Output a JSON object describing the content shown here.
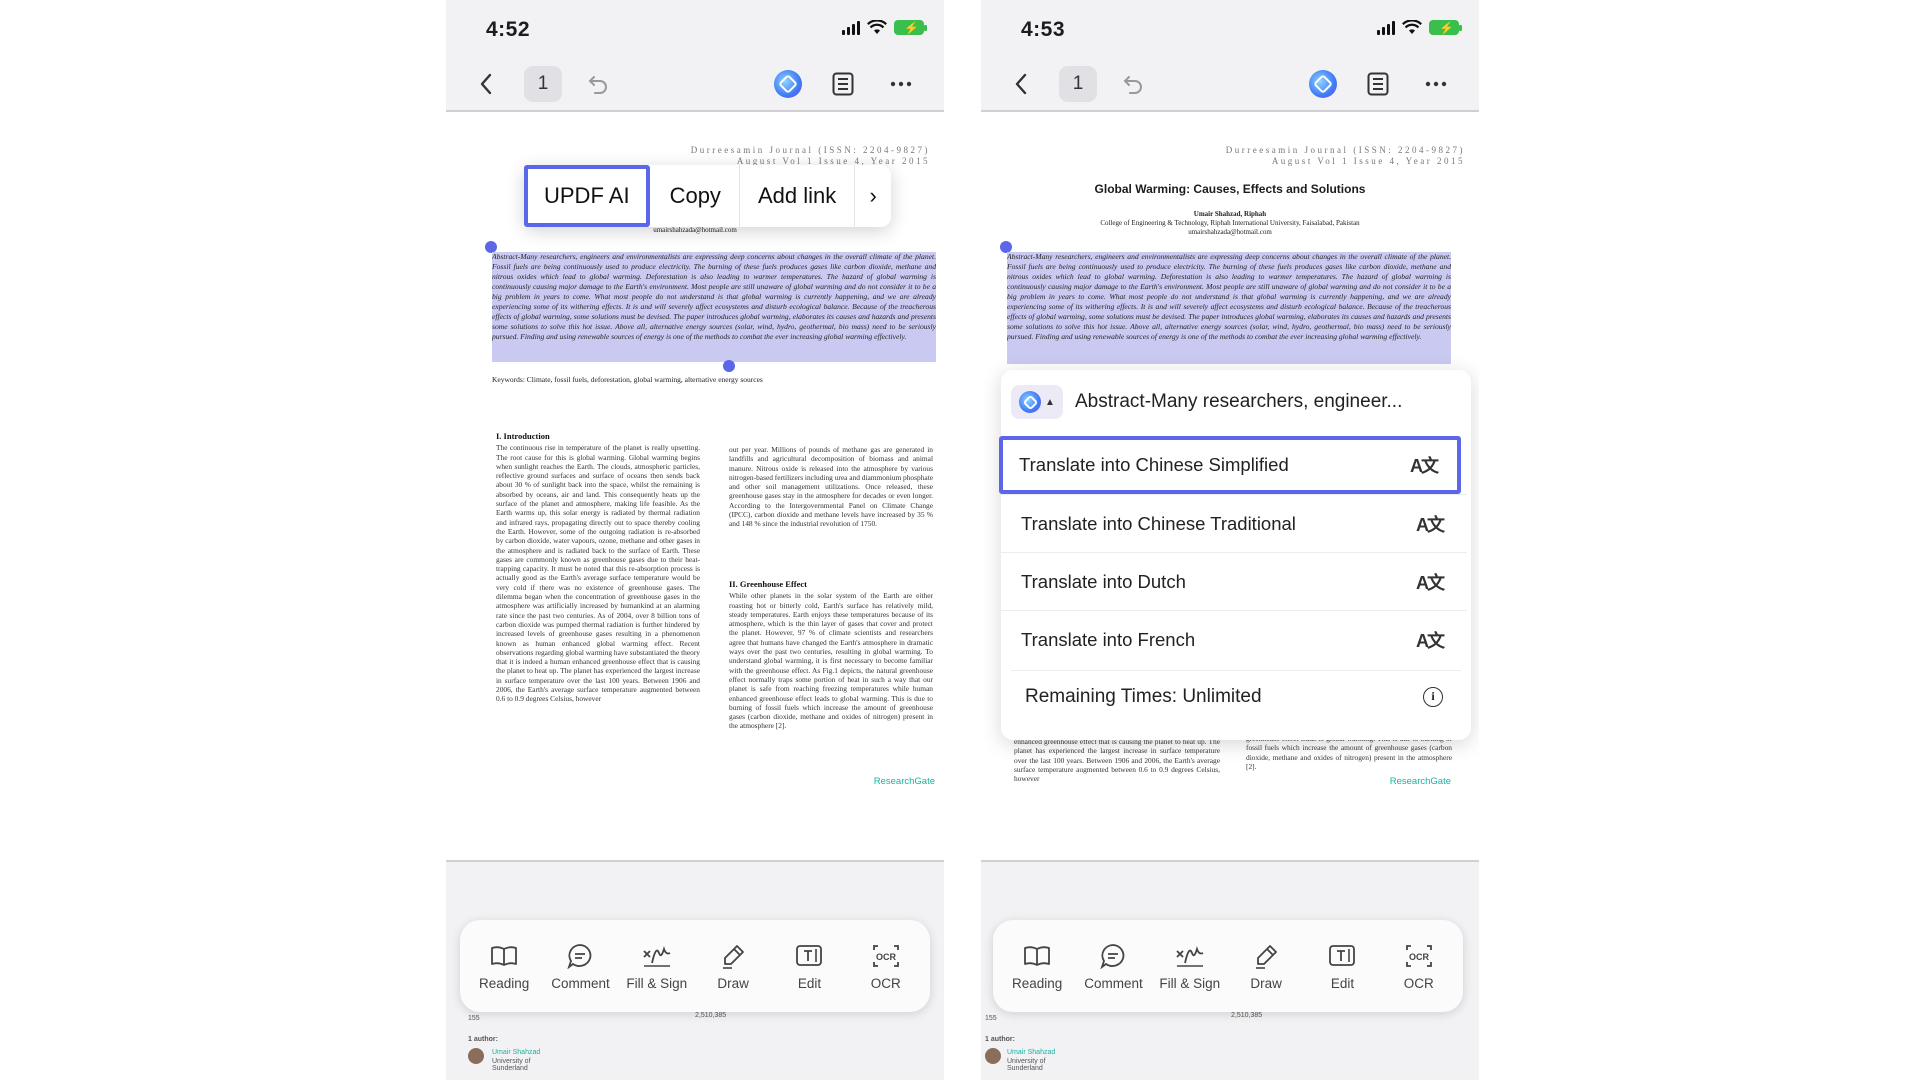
{
  "left_screen": {
    "status": {
      "time": "4:52"
    },
    "topbar": {
      "page": "1"
    },
    "context_menu": {
      "items": [
        "UPDF AI",
        "Copy",
        "Add link"
      ],
      "more": "›"
    }
  },
  "right_screen": {
    "status": {
      "time": "4:53"
    },
    "topbar": {
      "page": "1"
    },
    "ai_panel": {
      "header": "Abstract-Many researchers, engineer...",
      "options": [
        "Translate into Chinese Simplified",
        "Translate into Chinese Traditional",
        "Translate into Dutch",
        "Translate into French"
      ],
      "remaining": "Remaining Times: Unlimited"
    }
  },
  "document": {
    "journal_line1": "Durreesamin Journal (ISSN: 2204-9827)",
    "journal_line2": "August Vol 1 Issue 4, Year 2015",
    "title": "Global Warming: Causes, Effects and Solutions",
    "author": "Umair Shahzad, Riphah",
    "affiliation": "College of Engineering & Technology, Riphah International University, Faisalabad, Pakistan",
    "email": "umairshahzada@hotmail.com",
    "abstract": "Abstract-Many researchers, engineers and environmentalists are expressing deep concerns about changes in the overall climate of the planet. Fossil fuels are being continuously used to produce electricity. The burning of these fuels produces gases like carbon dioxide, methane and nitrous oxides which lead to global warming. Deforestation is also leading to warmer temperatures. The hazard of global warming is continuously causing major damage to the Earth's environment. Most people are still unaware of global warming and do not consider it to be a big problem in years to come. What most people do not understand is that global warming is currently happening, and we are already experiencing some of its withering effects. It is and will severely affect ecosystems and disturb ecological balance. Because of the treacherous effects of global warming, some solutions must be devised. The paper introduces global warming, elaborates its causes and hazards and presents some solutions to solve this hot issue. Above all, alternative energy sources (solar, wind, hydro, geothermal, bio mass) need to be seriously pursued. Finding and using renewable sources of energy is one of the methods to combat the ever increasing global warming effectively.",
    "keywords": "Keywords: Climate, fossil fuels, deforestation, global warming, alternative energy sources",
    "intro_heading": "I. Introduction",
    "intro_text": "The continuous rise in temperature of the planet is really upsetting. The root cause for this is global warming. Global warming begins when sunlight reaches the Earth. The clouds, atmospheric particles, reflective ground surfaces and surface of oceans then sends back about 30 % of sunlight back into the space, whilst the remaining is absorbed by oceans, air and land. This consequently heats up the surface of the planet and atmosphere, making life feasible. As the Earth warms up, this solar energy is radiated by thermal radiation and infrared rays, propagating directly out to space thereby cooling the Earth. However, some of the outgoing radiation is re-absorbed by carbon dioxide, water vapours, ozone, methane and other gases in the atmosphere and is radiated back to the surface of Earth. These gases are commonly known as greenhouse gases due to their heat-trapping capacity. It must be noted that this re-absorption process is actually good as the Earth's average surface temperature would be very cold if there was no existence of greenhouse gases. The dilemma began when the concentration of greenhouse gases in the atmosphere was artificially increased by humankind at an alarming rate since the past two centuries. As of 2004, over 8 billion tons of carbon dioxide was pumped thermal radiation is further hindered by increased levels of greenhouse gases resulting in a phenomenon known as human enhanced global warming effect. Recent observations regarding global warming have substantiated the theory that it is indeed a human enhanced greenhouse effect that is causing the planet to heat up. The planet has experienced the largest increase in surface temperature over the last 100 years. Between 1906 and 2006, the Earth's average surface temperature augmented between 0.6 to 0.9 degrees Celsius, however",
    "right_col_text": "out per year. Millions of pounds of methane gas are generated in landfills and agricultural decomposition of biomass and animal manure. Nitrous oxide is released into the atmosphere by various nitrogen-based fertilizers including urea and diammonium phosphate and other soil management utilizations. Once released, these greenhouse gases stay in the atmosphere for decades or even longer. According to the Intergovernmental Panel on Climate Change (IPCC), carbon dioxide and methane levels have increased by 35 % and 148 % since the industrial revolution of 1750.",
    "greenhouse_heading": "II. Greenhouse Effect",
    "greenhouse_text": "While other planets in the solar system of the Earth are either roasting hot or bitterly cold, Earth's surface has relatively mild, steady temperatures. Earth enjoys these temperatures because of its atmosphere, which is the thin layer of gases that cover and protect the planet. However, 97 % of climate scientists and researchers agree that humans have changed the Earth's atmosphere in dramatic ways over the past two centuries, resulting in global warming. To understand global warming, it is first necessary to become familiar with the greenhouse effect. As Fig.1 depicts, the natural greenhouse effect normally traps some portion of heat in such a way that our planet is safe from reaching freezing temperatures while human enhanced greenhouse effect leads to global warming. This is due to burning of fossil fuels which increase the amount of greenhouse gases (carbon dioxide, methane and oxides of nitrogen) present in the atmosphere [2].",
    "right_tail_left": "enhanced greenhouse effect that is causing the planet to heat up. The planet has experienced the largest increase in surface temperature over the last 100 years. Between 1906 and 2006, the Earth's average surface temperature augmented between 0.6 to 0.9 degrees Celsius, however",
    "right_tail_right": "greenhouse effect leads to global warming. This is due to burning of fossil fuels which increase the amount of greenhouse gases (carbon dioxide, methane and oxides of nitrogen) present in the atmosphere [2].",
    "watermark": "ResearchGate",
    "below_num1": "155",
    "below_num2": "2,510,385",
    "below_author_hdr": "1 author:",
    "below_author_name": "Umair Shahzad",
    "below_author_uni": "University of Sunderland"
  },
  "toolbar": {
    "items": [
      "Reading",
      "Comment",
      "Fill & Sign",
      "Draw",
      "Edit",
      "OCR"
    ]
  },
  "colors": {
    "accent": "#5b67e8",
    "selection": "#c9c9f2",
    "battery": "#3bbf4c",
    "researchgate": "#16b3a0"
  }
}
